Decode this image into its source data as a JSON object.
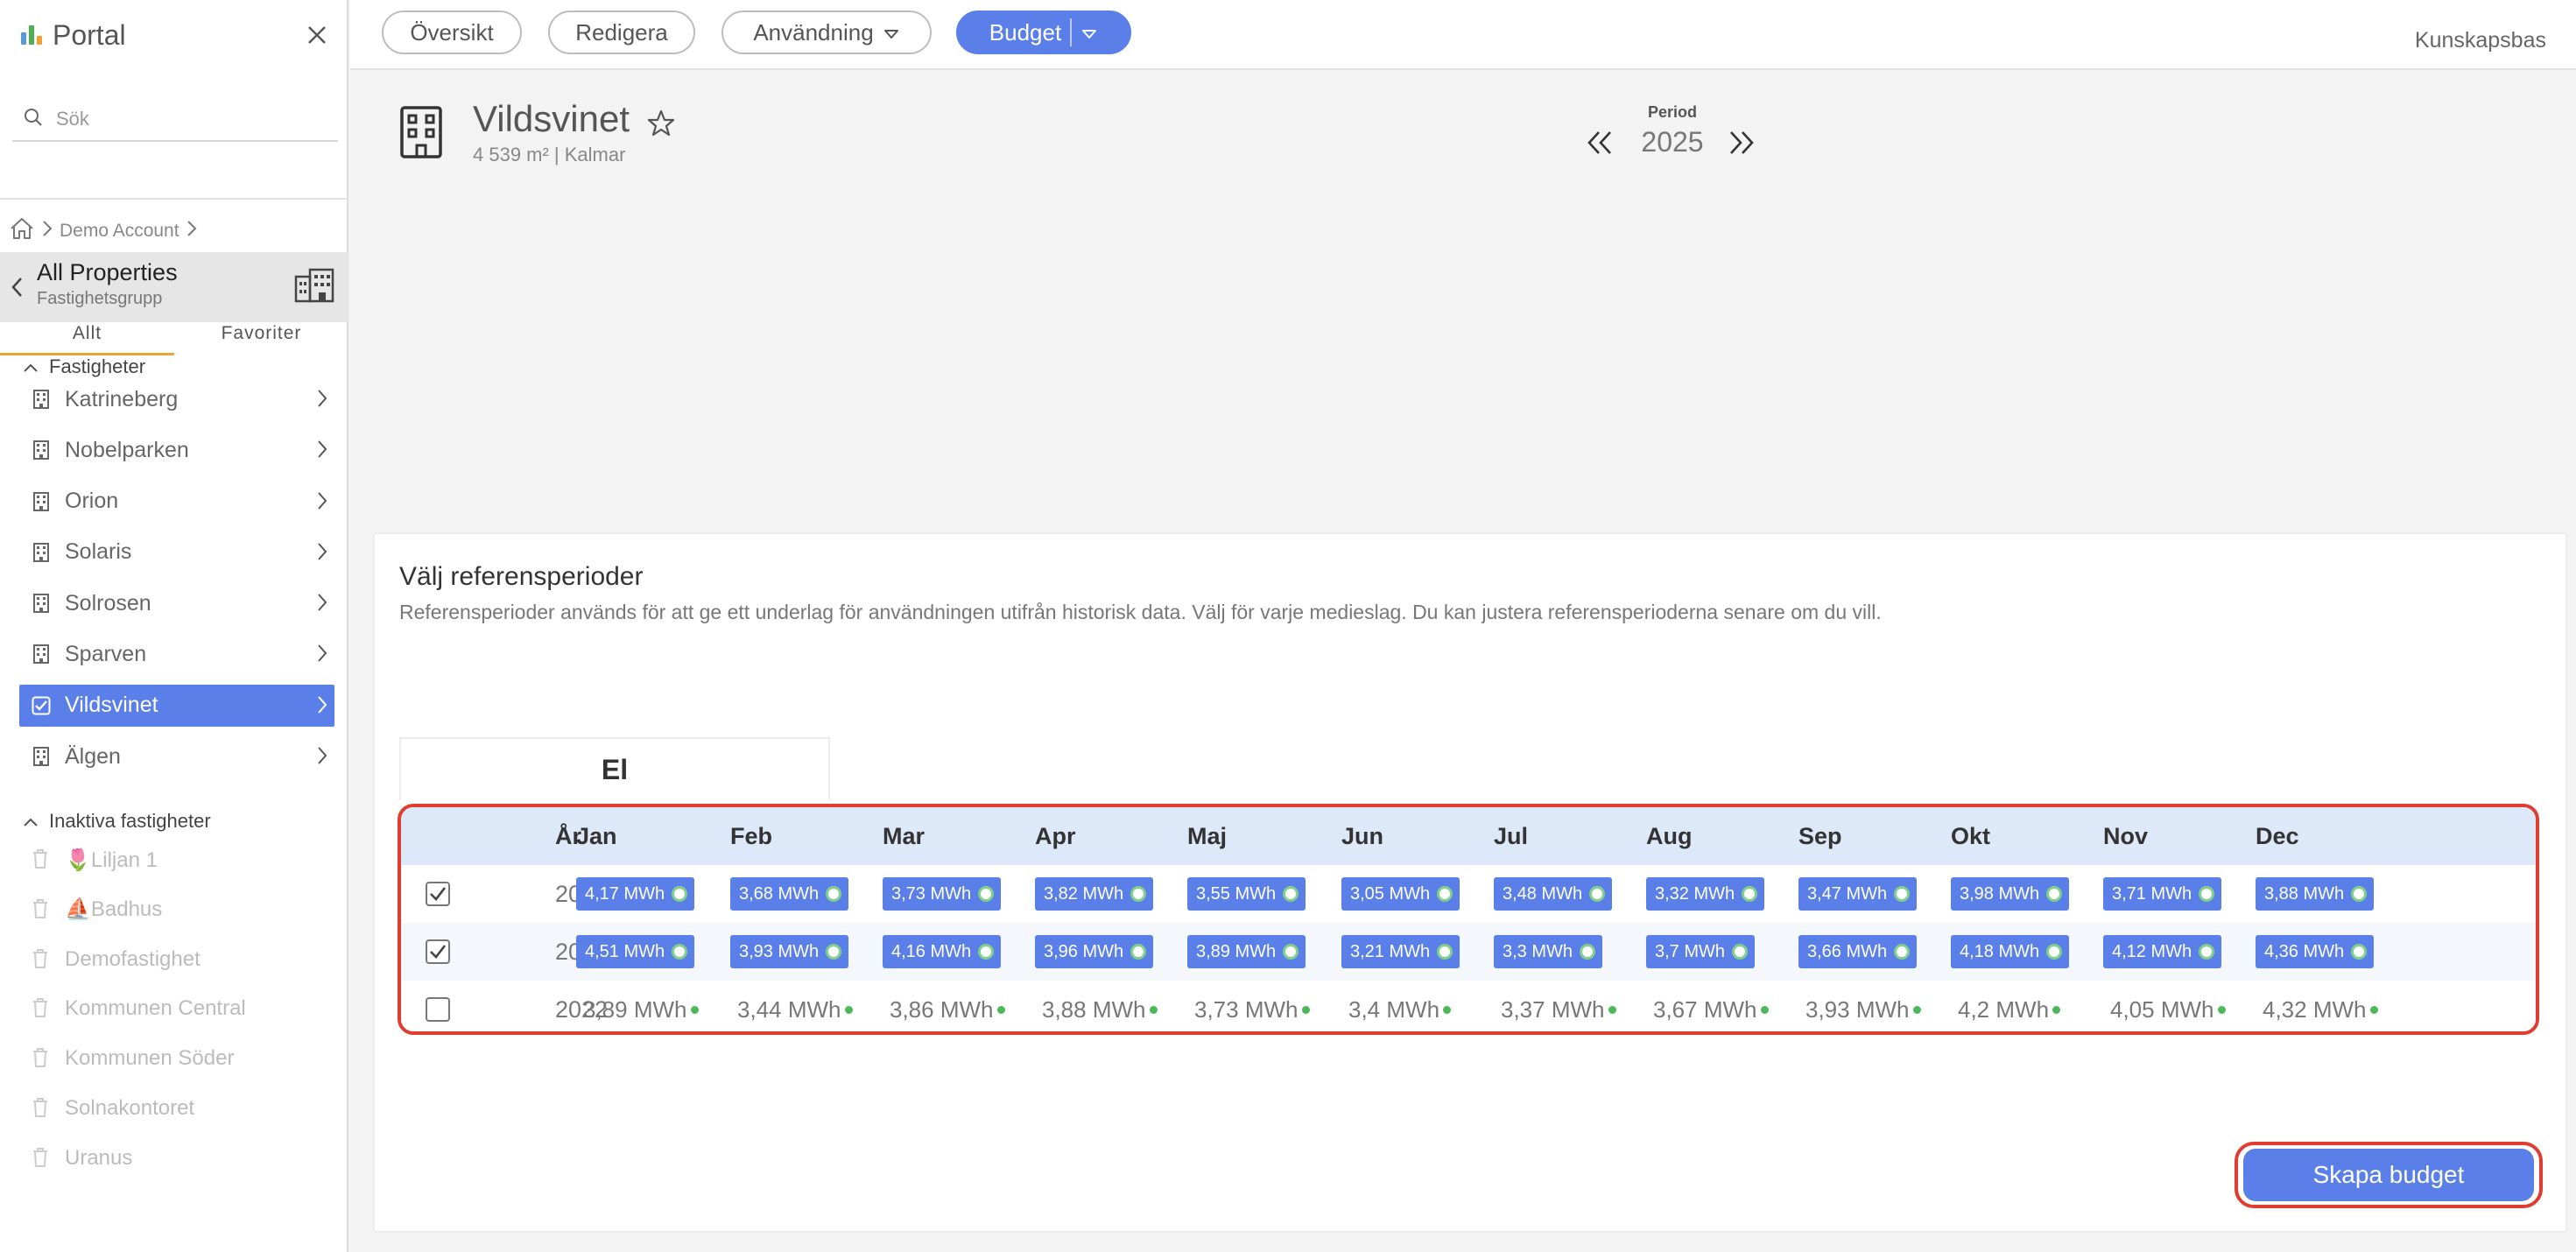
{
  "sidebar": {
    "brand": "Portal",
    "search_placeholder": "Sök",
    "tabs": [
      {
        "label": "Allt"
      },
      {
        "label": "Favoriter"
      }
    ],
    "breadcrumb": {
      "account": "Demo Account"
    },
    "group": {
      "title": "All Properties",
      "subtitle": "Fastighetsgrupp"
    },
    "active_section": "Fastigheter",
    "properties": [
      {
        "label": "Katrineberg"
      },
      {
        "label": "Nobelparken"
      },
      {
        "label": "Orion"
      },
      {
        "label": "Solaris"
      },
      {
        "label": "Solrosen"
      },
      {
        "label": "Sparven"
      },
      {
        "label": "Vildsvinet"
      },
      {
        "label": "Älgen"
      }
    ],
    "inactive_section": "Inaktiva fastigheter",
    "inactive": [
      {
        "label": "🌷Liljan 1"
      },
      {
        "label": "⛵Badhus"
      },
      {
        "label": "Demofastighet"
      },
      {
        "label": "Kommunen Central"
      },
      {
        "label": "Kommunen Söder"
      },
      {
        "label": "Solnakontoret"
      },
      {
        "label": "Uranus"
      }
    ]
  },
  "topbar": {
    "overview": "Översikt",
    "edit": "Redigera",
    "usage": "Användning",
    "budget": "Budget",
    "knowledge_base": "Kunskapsbas"
  },
  "property": {
    "name": "Vildsvinet",
    "meta": "4 539 m² | Kalmar"
  },
  "period": {
    "label": "Period",
    "value": "2025"
  },
  "reference": {
    "title": "Välj referensperioder",
    "description": "Referensperioder används för att ge ett underlag för användningen utifrån historisk data. Välj för varje medieslag. Du kan justera referensperioderna senare om du vill.",
    "media_tab": "El",
    "year_header": "År",
    "months": [
      "Jan",
      "Feb",
      "Mar",
      "Apr",
      "Maj",
      "Jun",
      "Jul",
      "Aug",
      "Sep",
      "Okt",
      "Nov",
      "Dec"
    ],
    "rows": [
      {
        "year": "2024",
        "checked": true,
        "values": [
          "4,17 MWh",
          "3,68 MWh",
          "3,73 MWh",
          "3,82 MWh",
          "3,55 MWh",
          "3,05 MWh",
          "3,48 MWh",
          "3,32 MWh",
          "3,47 MWh",
          "3,98 MWh",
          "3,71 MWh",
          "3,88 MWh"
        ]
      },
      {
        "year": "2023",
        "checked": true,
        "values": [
          "4,51 MWh",
          "3,93 MWh",
          "4,16 MWh",
          "3,96 MWh",
          "3,89 MWh",
          "3,21 MWh",
          "3,3 MWh",
          "3,7 MWh",
          "3,66 MWh",
          "4,18 MWh",
          "4,12 MWh",
          "4,36 MWh"
        ]
      },
      {
        "year": "2022",
        "checked": false,
        "values": [
          "3,89 MWh",
          "3,44 MWh",
          "3,86 MWh",
          "3,88 MWh",
          "3,73 MWh",
          "3,4 MWh",
          "3,37 MWh",
          "3,67 MWh",
          "3,93 MWh",
          "4,2 MWh",
          "4,05 MWh",
          "4,32 MWh"
        ]
      }
    ],
    "create_button": "Skapa budget"
  },
  "colors": {
    "accent": "#5b7fe8",
    "highlight": "#e03c2f",
    "status_ok": "#4cb85a",
    "tab_underline": "#e8a53a"
  }
}
